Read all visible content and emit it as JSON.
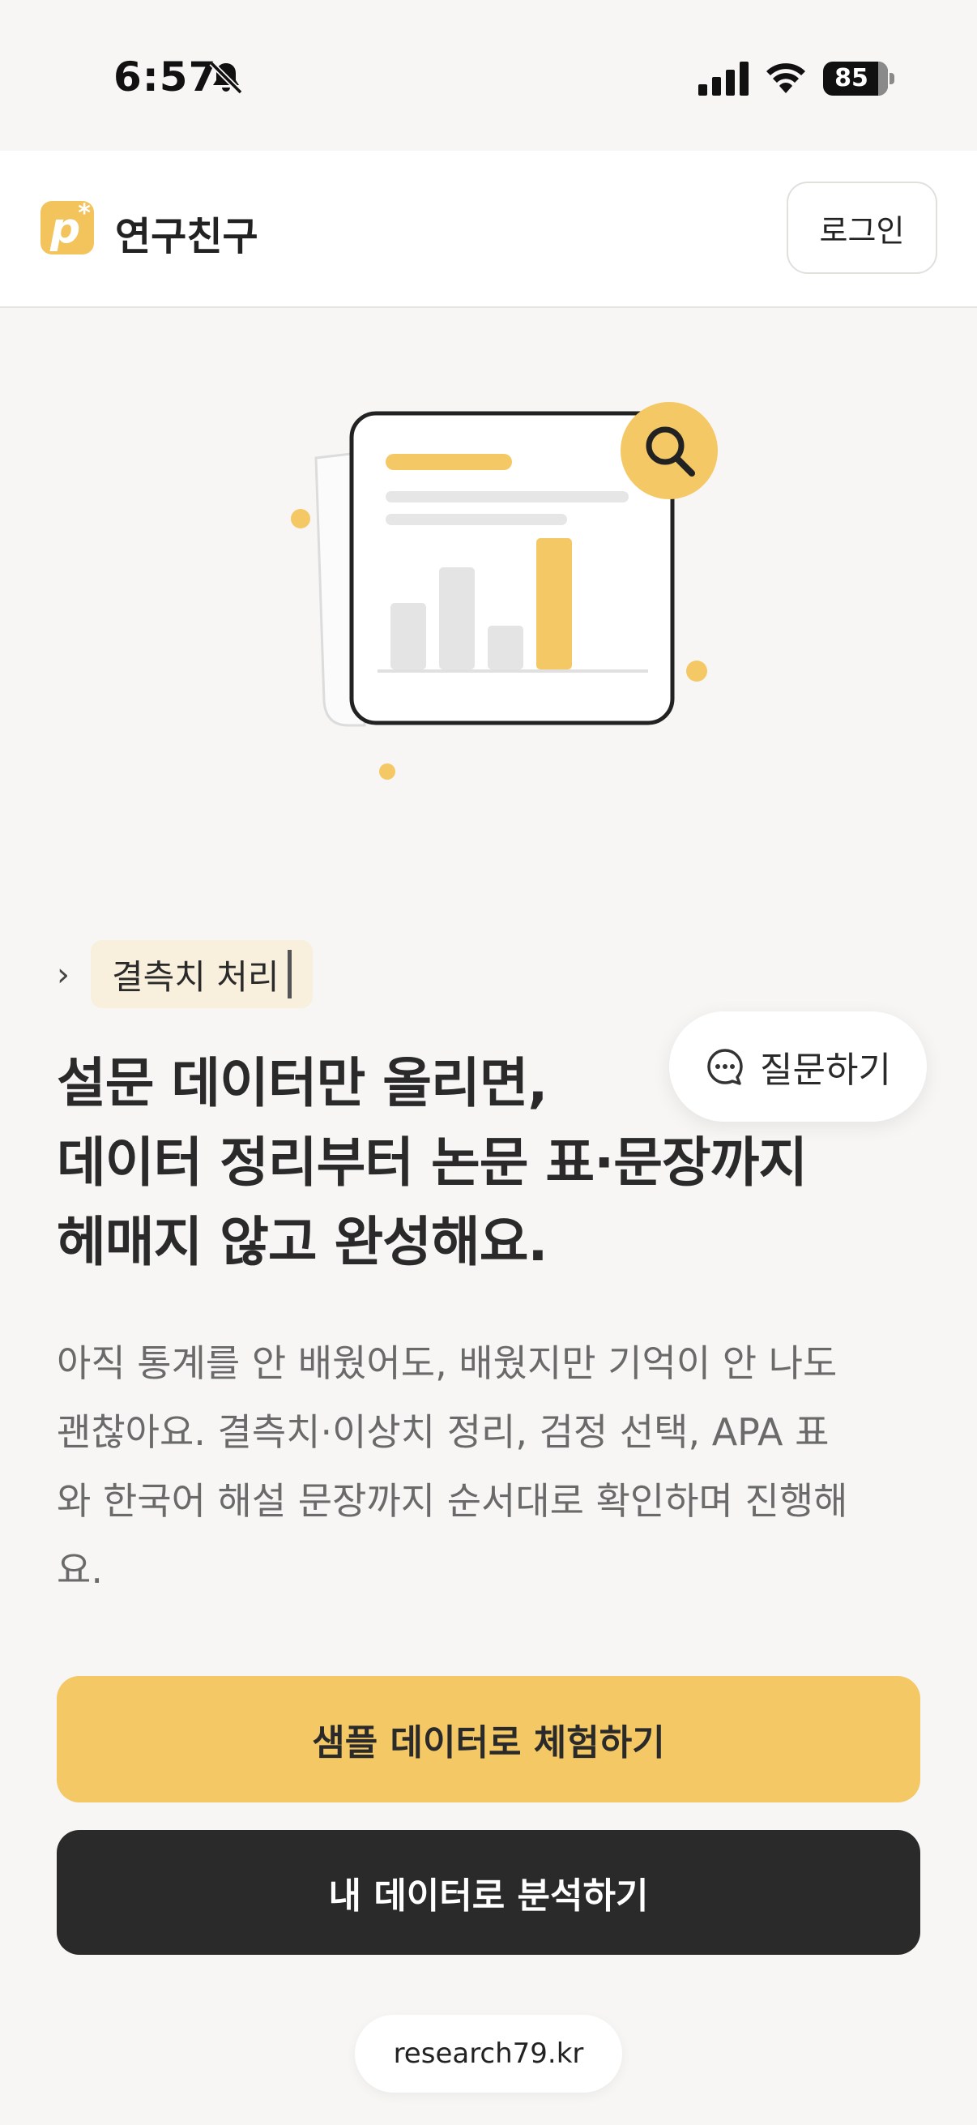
{
  "status_bar": {
    "time": "6:57",
    "battery": "85",
    "icons": [
      "bell-slash-icon",
      "signal-icon",
      "wifi-icon",
      "battery-icon"
    ]
  },
  "header": {
    "logo_letter": "p",
    "logo_mark": "*",
    "brand": "연구친구",
    "login_label": "로그인"
  },
  "hero": {
    "tag_text": "결측치 처리",
    "headline_lines": [
      "설문 데이터만 올리면,",
      "데이터 정리부터 논문 표·문장까지",
      "헤매지 않고 완성해요."
    ],
    "body_lines": [
      "아직 통계를 안 배웠어도, 배웠지만 기억이 안 나도",
      "괜찮아요. 결측치·이상치 정리, 검정 선택, APA 표",
      "와 한국어 해설 문장까지 순서대로 확인하며 진행해",
      "요."
    ]
  },
  "ask_button_label": "질문하기",
  "cta": {
    "primary_label": "샘플 데이터로 체험하기",
    "secondary_label": "내 데이터로 분석하기"
  },
  "url": "research79.kr",
  "colors": {
    "accent": "#f4c865",
    "dark": "#2a2a2a",
    "background": "#f7f6f4"
  }
}
